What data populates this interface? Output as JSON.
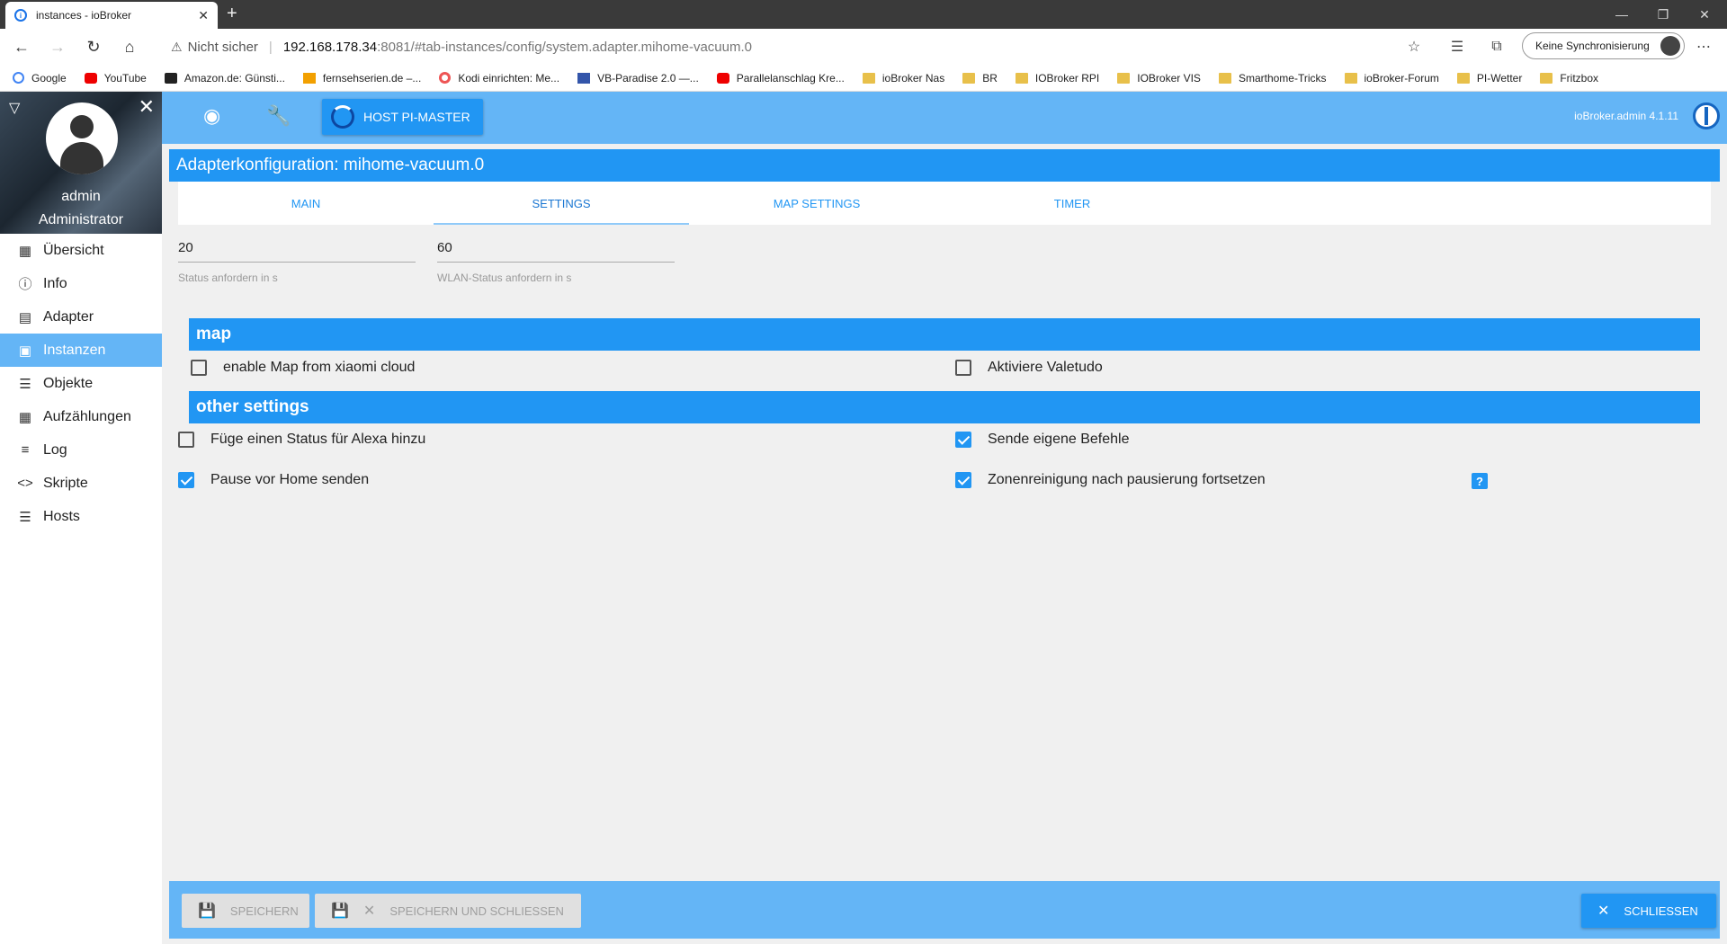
{
  "browser": {
    "tab_title": "instances - ioBroker",
    "tab_close": "✕",
    "new_tab": "+",
    "security_label": "Nicht sicher",
    "url_host": "192.168.178.34",
    "url_path": ":8081/#tab-instances/config/system.adapter.mihome-vacuum.0",
    "sync_label": "Keine Synchronisierung",
    "bookmarks": [
      "Google",
      "YouTube",
      "Amazon.de: Günsti...",
      "fernsehserien.de –...",
      "Kodi einrichten: Me...",
      "VB-Paradise 2.0 —...",
      "Parallelanschlag Kre...",
      "ioBroker Nas",
      "BR",
      "IOBroker RPI",
      "IOBroker VIS",
      "Smarthome-Tricks",
      "ioBroker-Forum",
      "PI-Wetter",
      "Fritzbox"
    ]
  },
  "sidebar": {
    "username": "admin",
    "role": "Administrator",
    "items": [
      {
        "label": "Übersicht",
        "icon": "grid-icon"
      },
      {
        "label": "Info",
        "icon": "info-icon"
      },
      {
        "label": "Adapter",
        "icon": "store-icon"
      },
      {
        "label": "Instanzen",
        "icon": "instances-icon"
      },
      {
        "label": "Objekte",
        "icon": "list-icon"
      },
      {
        "label": "Aufzählungen",
        "icon": "enum-icon"
      },
      {
        "label": "Log",
        "icon": "log-icon"
      },
      {
        "label": "Skripte",
        "icon": "code-icon"
      },
      {
        "label": "Hosts",
        "icon": "hosts-icon"
      }
    ]
  },
  "topbar": {
    "host_button": "HOST PI-MASTER",
    "version": "ioBroker.admin 4.1.11"
  },
  "config": {
    "title": "Adapterkonfiguration: mihome-vacuum.0",
    "tabs": [
      "MAIN",
      "SETTINGS",
      "MAP SETTINGS",
      "TIMER"
    ],
    "status_value": "20",
    "status_label": "Status anfordern in s",
    "wlan_value": "60",
    "wlan_label": "WLAN-Status anfordern in s",
    "section_map": "map",
    "cb_enable_map": "enable Map from xiaomi cloud",
    "cb_valetudo": "Aktiviere Valetudo",
    "section_other": "other settings",
    "cb_alexa": "Füge einen Status für Alexa hinzu",
    "cb_own_commands": "Sende eigene Befehle",
    "cb_pause_home": "Pause vor Home senden",
    "cb_zone_resume": "Zonenreinigung nach pausierung fortsetzen",
    "help": "?"
  },
  "footer": {
    "save": "SPEICHERN",
    "save_close": "SPEICHERN UND SCHLIESSEN",
    "close": "SCHLIESSEN"
  },
  "colors": {
    "accent": "#2196f3",
    "light_accent": "#64b5f6"
  }
}
